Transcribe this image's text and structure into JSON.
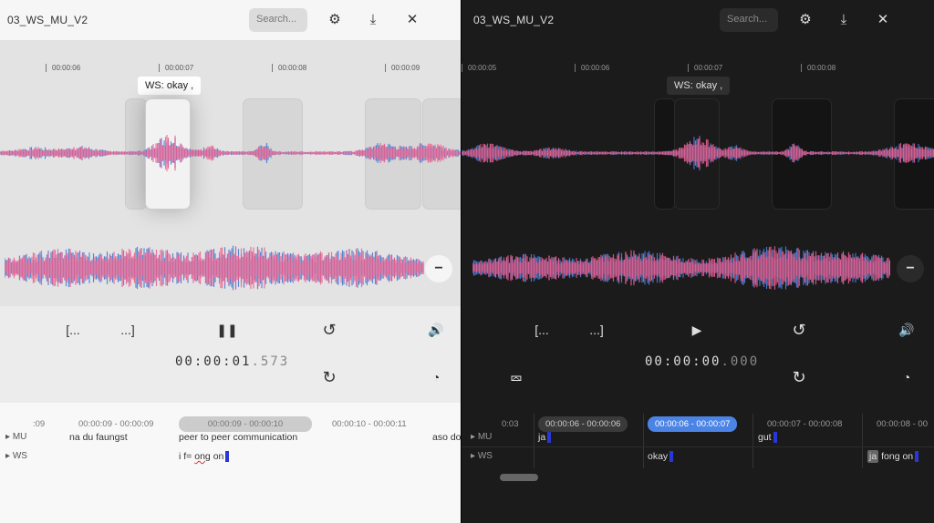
{
  "light": {
    "title": "03_WS_MU_V2",
    "search_placeholder": "Search...",
    "icons": {
      "settings": "gear-icon",
      "download": "download-icon",
      "tools": "tools-icon"
    },
    "ticks": [
      "00:00:06",
      "00:00:07",
      "00:00:08",
      "00:00:09"
    ],
    "tooltip": "WS: okay ,",
    "controls": {
      "seg_start": "[...",
      "seg_end": "...]"
    },
    "time_main": "00:00:01",
    "time_ms": ".573",
    "timestamps": [
      ":09",
      "00:00:09 - 00:00:09",
      "00:00:09 - 00:00:10",
      "00:00:10 - 00:00:11"
    ],
    "tracks": [
      {
        "label": "MU",
        "texts": [
          "na du faungst",
          "peer to peer communication",
          "aso do"
        ]
      },
      {
        "label": "WS",
        "texts": [
          "i f=",
          "ong",
          "on"
        ]
      }
    ]
  },
  "dark": {
    "title": "03_WS_MU_V2",
    "search_placeholder": "Search...",
    "icons": {
      "settings": "gear-icon",
      "download": "download-icon",
      "tools": "tools-icon"
    },
    "ticks": [
      "00:00:05",
      "00:00:06",
      "00:00:07",
      "00:00:08"
    ],
    "tooltip": "WS: okay ,",
    "controls": {
      "seg_start": "[...",
      "seg_end": "...]"
    },
    "time_main": "00:00:00",
    "time_ms": ".000",
    "timestamps": [
      "0:03",
      "00:00:06 - 00:00:06",
      "00:00:06 - 00:00:07",
      "00:00:07 - 00:00:08",
      "00:00:08 - 00"
    ],
    "tracks": [
      {
        "label": "MU",
        "texts": [
          "ja",
          "gut"
        ]
      },
      {
        "label": "WS",
        "texts": [
          "okay",
          "ja",
          "fong on"
        ]
      }
    ]
  },
  "colors": {
    "accent": "#5b8de0",
    "wave_pink": "#ef5d8c",
    "wave_blue": "#4a7fd4",
    "cursor": "#2a37d6"
  }
}
